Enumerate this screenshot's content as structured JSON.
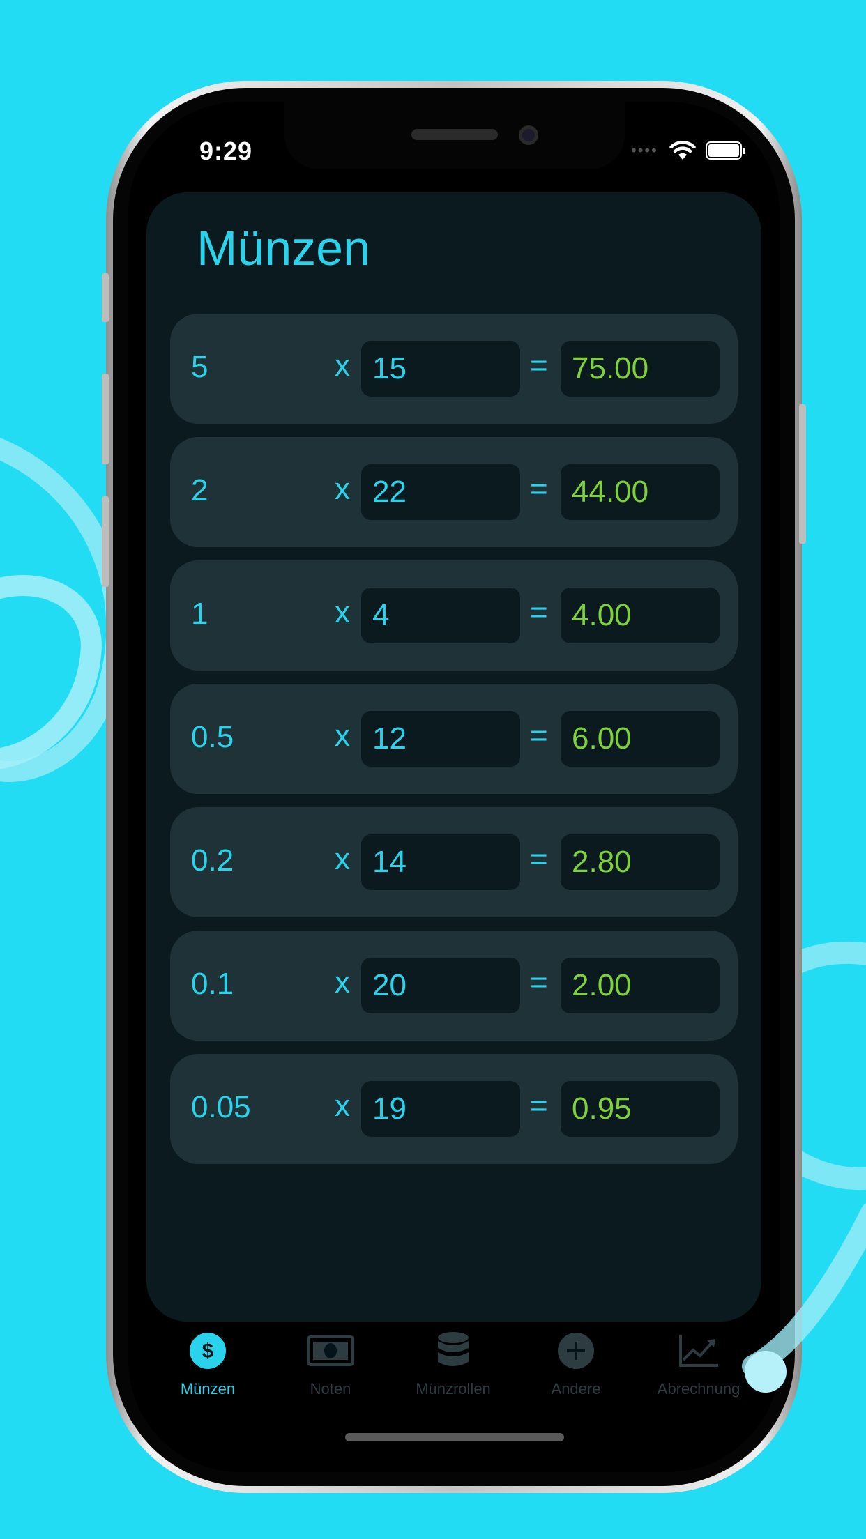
{
  "status_bar": {
    "time": "9:29"
  },
  "page_title": "Münzen",
  "rows": [
    {
      "denomination": "5",
      "times": "x",
      "quantity": "15",
      "equals": "=",
      "total": "75.00"
    },
    {
      "denomination": "2",
      "times": "x",
      "quantity": "22",
      "equals": "=",
      "total": "44.00"
    },
    {
      "denomination": "1",
      "times": "x",
      "quantity": "4",
      "equals": "=",
      "total": "4.00"
    },
    {
      "denomination": "0.5",
      "times": "x",
      "quantity": "12",
      "equals": "=",
      "total": "6.00"
    },
    {
      "denomination": "0.2",
      "times": "x",
      "quantity": "14",
      "equals": "=",
      "total": "2.80"
    },
    {
      "denomination": "0.1",
      "times": "x",
      "quantity": "20",
      "equals": "=",
      "total": "2.00"
    },
    {
      "denomination": "0.05",
      "times": "x",
      "quantity": "19",
      "equals": "=",
      "total": "0.95"
    }
  ],
  "tabs": [
    {
      "label": "Münzen",
      "icon": "dollar-coin-icon",
      "active": true
    },
    {
      "label": "Noten",
      "icon": "banknote-icon",
      "active": false
    },
    {
      "label": "Münzrollen",
      "icon": "coin-roll-icon",
      "active": false
    },
    {
      "label": "Andere",
      "icon": "plus-circle-icon",
      "active": false
    },
    {
      "label": "Abrechnung",
      "icon": "chart-icon",
      "active": false
    }
  ],
  "colors": {
    "background": "#22dcf3",
    "accent": "#2ad3ec",
    "total_text": "#7ed13a",
    "card": "#0a1a1f",
    "row": "#1f3237"
  }
}
